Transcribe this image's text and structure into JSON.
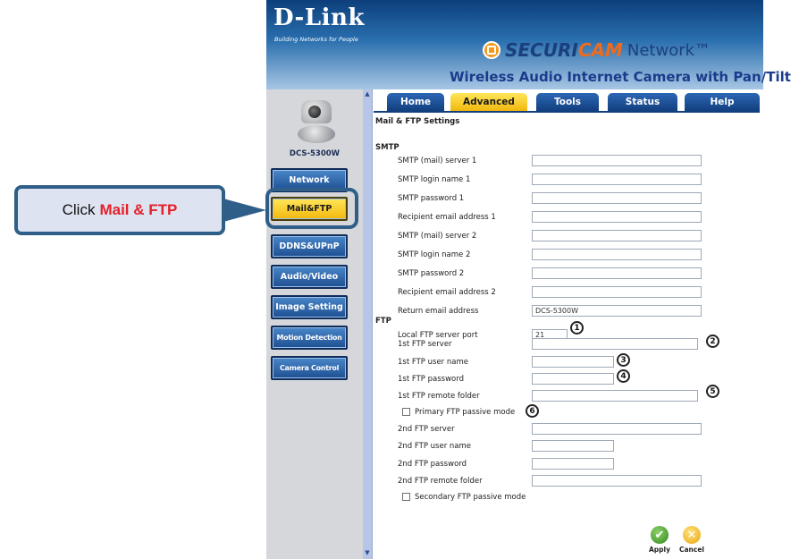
{
  "brand": {
    "logo": "D-Link",
    "tagline": "Building Networks for People"
  },
  "product_line": {
    "prefix": "SECURI",
    "highlight": "CAM",
    "suffix": "Network™"
  },
  "product_name": "Wireless Audio Internet Camera with Pan/Tilt",
  "camera_model": "DCS-5300W",
  "sidebar": {
    "items": [
      {
        "label": "Network"
      },
      {
        "label": "Mail&FTP"
      },
      {
        "label": "DDNS&UPnP"
      },
      {
        "label": "Audio/Video"
      },
      {
        "label": "Image Setting"
      },
      {
        "label": "Motion Detection"
      },
      {
        "label": "Camera Control"
      }
    ]
  },
  "callout": {
    "prefix": "Click",
    "highlight": "Mail & FTP"
  },
  "tabs": [
    {
      "label": "Home"
    },
    {
      "label": "Advanced"
    },
    {
      "label": "Tools"
    },
    {
      "label": "Status"
    },
    {
      "label": "Help"
    }
  ],
  "page_title": "Mail & FTP Settings",
  "smtp": {
    "section": "SMTP",
    "fields": [
      {
        "label": "SMTP (mail) server 1",
        "value": ""
      },
      {
        "label": "SMTP login name 1",
        "value": ""
      },
      {
        "label": "SMTP password 1",
        "value": ""
      },
      {
        "label": "Recipient email address 1",
        "value": ""
      },
      {
        "label": "SMTP (mail) server 2",
        "value": ""
      },
      {
        "label": "SMTP login name 2",
        "value": ""
      },
      {
        "label": "SMTP password 2",
        "value": ""
      },
      {
        "label": "Recipient email address 2",
        "value": ""
      },
      {
        "label": "Return email address",
        "value": "DCS-5300W"
      }
    ]
  },
  "ftp": {
    "section": "FTP",
    "local_port": {
      "label": "Local FTP server port",
      "value": "21"
    },
    "server1": {
      "label": "1st FTP server",
      "value": ""
    },
    "user1": {
      "label": "1st FTP user name",
      "value": ""
    },
    "pass1": {
      "label": "1st FTP password",
      "value": ""
    },
    "folder1": {
      "label": "1st FTP remote folder",
      "value": ""
    },
    "passive1": {
      "label": "Primary FTP passive mode",
      "checked": false
    },
    "server2": {
      "label": "2nd FTP server",
      "value": ""
    },
    "user2": {
      "label": "2nd FTP user name",
      "value": ""
    },
    "pass2": {
      "label": "2nd FTP password",
      "value": ""
    },
    "folder2": {
      "label": "2nd FTP remote folder",
      "value": ""
    },
    "passive2": {
      "label": "Secondary FTP passive mode",
      "checked": false
    }
  },
  "markers": [
    "1",
    "2",
    "3",
    "4",
    "5",
    "6"
  ],
  "actions": {
    "apply": "Apply",
    "cancel": "Cancel"
  },
  "colors": {
    "accent": "#f2b80e",
    "nav": "#1d4f92",
    "callout_border": "#2f5e88",
    "highlight_text": "#e5202a"
  }
}
